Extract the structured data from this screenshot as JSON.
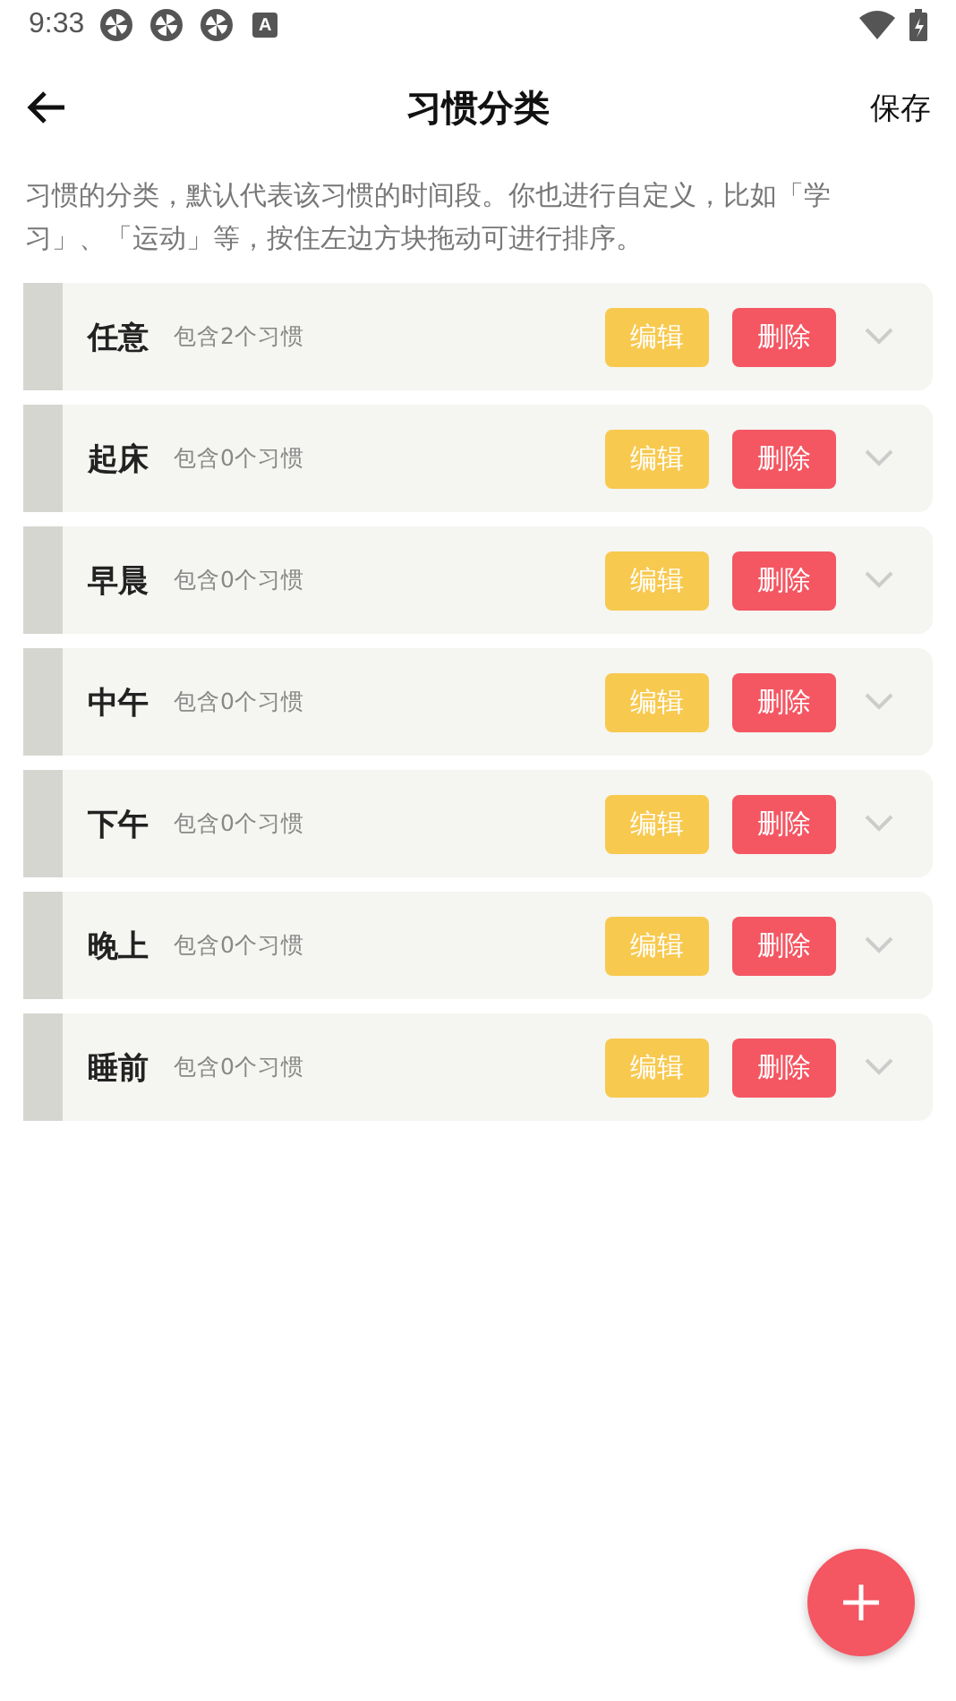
{
  "status_bar": {
    "time": "9:33",
    "letter_icon": "A"
  },
  "header": {
    "title": "习惯分类",
    "action": "保存"
  },
  "description": "习惯的分类，默认代表该习惯的时间段。你也进行自定义，比如「学习」、「运动」等，按住左边方块拖动可进行排序。",
  "categories": [
    {
      "name": "任意",
      "count": "包含2个习惯",
      "edit": "编辑",
      "delete": "删除",
      "expanded": false
    },
    {
      "name": "起床",
      "count": "包含0个习惯",
      "edit": "编辑",
      "delete": "删除",
      "expanded": false
    },
    {
      "name": "早晨",
      "count": "包含0个习惯",
      "edit": "编辑",
      "delete": "删除",
      "expanded": false
    },
    {
      "name": "中午",
      "count": "包含0个习惯",
      "edit": "编辑",
      "delete": "删除",
      "expanded": false
    },
    {
      "name": "下午",
      "count": "包含0个习惯",
      "edit": "编辑",
      "delete": "删除",
      "expanded": false
    },
    {
      "name": "晚上",
      "count": "包含0个习惯",
      "edit": "编辑",
      "delete": "删除",
      "expanded": false
    },
    {
      "name": "睡前",
      "count": "包含0个习惯",
      "edit": "编辑",
      "delete": "删除",
      "expanded": false
    }
  ]
}
